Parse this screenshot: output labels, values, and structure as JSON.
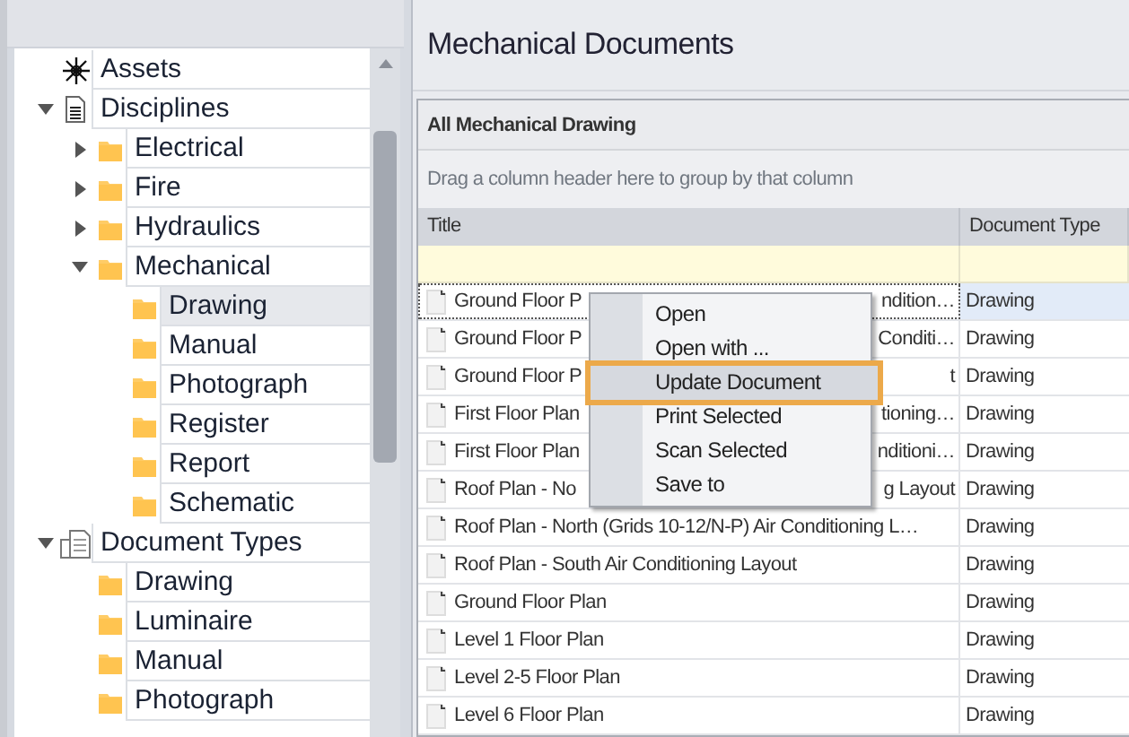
{
  "tree": [
    {
      "label": "Assets",
      "kind": "assets"
    },
    {
      "label": "Disciplines",
      "kind": "list",
      "expanded": true,
      "children": [
        {
          "label": "Electrical",
          "kind": "folder",
          "expanded": false
        },
        {
          "label": "Fire",
          "kind": "folder",
          "expanded": false
        },
        {
          "label": "Hydraulics",
          "kind": "folder",
          "expanded": false
        },
        {
          "label": "Mechanical",
          "kind": "folder",
          "expanded": true,
          "children": [
            {
              "label": "Drawing",
              "kind": "folder",
              "selected": true
            },
            {
              "label": "Manual",
              "kind": "folder",
              "selected": false
            },
            {
              "label": "Photograph",
              "kind": "folder",
              "selected": false
            },
            {
              "label": "Register",
              "kind": "folder",
              "selected": false
            },
            {
              "label": "Report",
              "kind": "folder",
              "selected": false
            },
            {
              "label": "Schematic",
              "kind": "folder",
              "selected": false
            }
          ]
        }
      ]
    },
    {
      "label": "Document Types",
      "kind": "types",
      "expanded": true,
      "children": [
        {
          "label": "Drawing",
          "kind": "folder"
        },
        {
          "label": "Luminaire",
          "kind": "folder"
        },
        {
          "label": "Manual",
          "kind": "folder"
        },
        {
          "label": "Photograph",
          "kind": "folder"
        }
      ]
    }
  ],
  "page_title": "Mechanical Documents",
  "grid": {
    "title": "All Mechanical Drawing",
    "group_hint": "Drag a column header here to group by that column",
    "columns": [
      "Title",
      "Document Type"
    ],
    "rows": [
      {
        "title": "Ground Floor P",
        "title_end": "ndition…",
        "type": "Drawing",
        "selected": true
      },
      {
        "title": "Ground Floor P",
        "title_end": "Conditi…",
        "type": "Drawing",
        "selected": false
      },
      {
        "title": "Ground Floor P",
        "title_end": "t",
        "type": "Drawing",
        "selected": false
      },
      {
        "title": "First Floor Plan",
        "title_end": "tioning…",
        "type": "Drawing",
        "selected": false
      },
      {
        "title": "First Floor Plan",
        "title_end": "nditioni…",
        "type": "Drawing",
        "selected": false
      },
      {
        "title": "Roof Plan - No",
        "title_end": "g Layout",
        "type": "Drawing",
        "selected": false
      },
      {
        "title": "Roof Plan - North (Grids 10-12/N-P) Air Conditioning L…",
        "type": "Drawing",
        "selected": false
      },
      {
        "title": "Roof Plan - South Air Conditioning Layout",
        "type": "Drawing",
        "selected": false
      },
      {
        "title": "Ground Floor Plan",
        "type": "Drawing",
        "selected": false
      },
      {
        "title": "Level 1 Floor Plan",
        "type": "Drawing",
        "selected": false
      },
      {
        "title": "Level 2-5 Floor Plan",
        "type": "Drawing",
        "selected": false
      },
      {
        "title": "Level 6 Floor Plan",
        "type": "Drawing",
        "selected": false
      }
    ]
  },
  "context_menu": [
    {
      "label": "Open",
      "selected": false
    },
    {
      "label": "Open with ...",
      "selected": false
    },
    {
      "label": "Update Document",
      "selected": true
    },
    {
      "label": "Print Selected",
      "selected": false
    },
    {
      "label": "Scan Selected",
      "selected": false
    },
    {
      "label": "Save to",
      "selected": false
    }
  ]
}
